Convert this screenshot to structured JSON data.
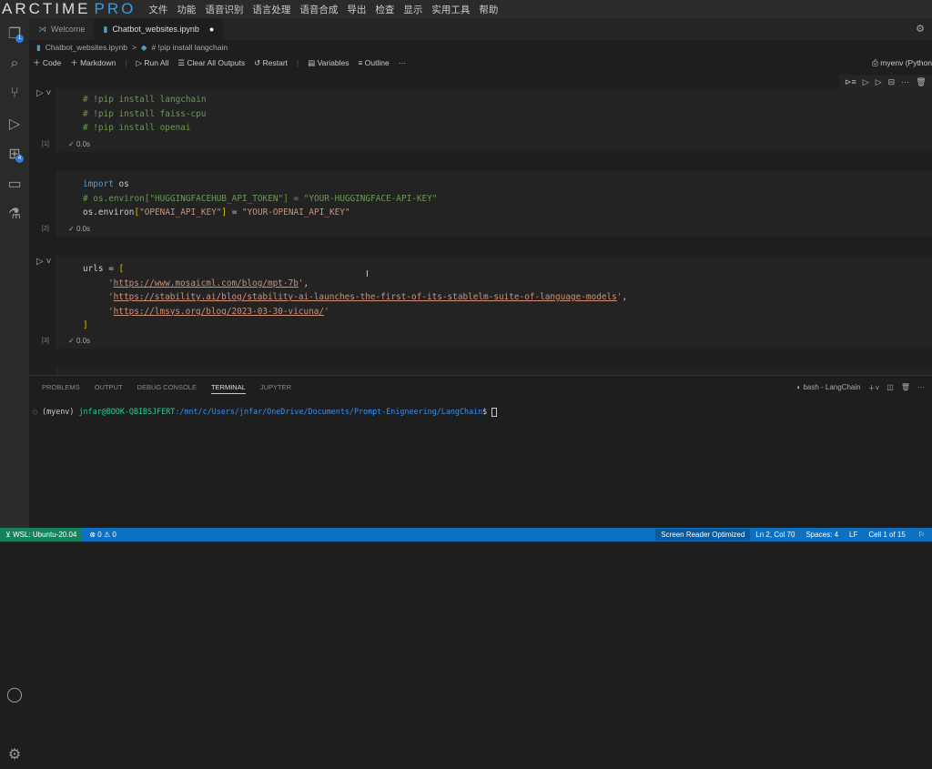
{
  "app": {
    "logo": "ARCTIME PRO",
    "menu": [
      "文件",
      "功能",
      "语音识别",
      "语言处理",
      "语音合成",
      "导出",
      "检查",
      "显示",
      "实用工具",
      "帮助"
    ]
  },
  "activity": {
    "explorer_badge": "1",
    "extensions_badge": "4"
  },
  "tabs": [
    {
      "label": "Welcome"
    },
    {
      "label": "Chatbot_websites.ipynb"
    }
  ],
  "breadcrumb": {
    "file": "Chatbot_websites.ipynb",
    "symbol": "# !pip install langchain",
    "sep": ">"
  },
  "toolbar": {
    "code": "Code",
    "markdown": "Markdown",
    "run_all": "Run All",
    "clear": "Clear All Outputs",
    "restart": "Restart",
    "variables": "Variables",
    "outline": "Outline",
    "more": "···"
  },
  "kernel": "myenv (Python",
  "cells": [
    {
      "count": "[1]",
      "time": "0.0s",
      "lines": [
        "# !pip install langchain",
        "# !pip install faiss-cpu",
        "# !pip install openai"
      ]
    },
    {
      "count": "[2]",
      "time": "0.0s",
      "import_kw": "import",
      "import_mod": " os",
      "comment": "# os.environ[\"HUGGINGFACEHUB_API_TOKEN\"] = \"YOUR-HUGGINGFACE-API-KEY\"",
      "l3a": "os.environ",
      "l3b": "[",
      "l3c": "\"OPENAI_API_KEY\"",
      "l3d": "]",
      "l3e": " = ",
      "l3f": "\"YOUR-OPENAI_API_KEY\""
    },
    {
      "count": "[3]",
      "time": "0.0s",
      "head": "urls = ",
      "open": "[",
      "close": "]",
      "urls": [
        "https://www.mosaicml.com/blog/mpt-7b",
        "https://stability.ai/blog/stability-ai-launches-the-first-of-its-stablelm-suite-of-language-models",
        "https://lmsys.org/blog/2023-03-30-vicuna/"
      ]
    }
  ],
  "panel": {
    "tabs": [
      "PROBLEMS",
      "OUTPUT",
      "DEBUG CONSOLE",
      "TERMINAL",
      "JUPYTER"
    ],
    "terminal_name": "bash - LangChain",
    "prompt": {
      "env": "(myenv) ",
      "user": "jnfar@BOOK-QBIBSJFERT",
      "path": ":/mnt/c/Users/jnfar/OneDrive/Documents/Prompt-Enigneering/LangChain",
      "dollar": "$ "
    }
  },
  "status": {
    "remote": "WSL: Ubuntu-20.04",
    "errors": "0",
    "warnings": "0",
    "screen_reader": "Screen Reader Optimized",
    "position": "Ln 2, Col 70",
    "spaces": "Spaces: 4",
    "eol": "LF",
    "cell": "Cell 1 of 15"
  }
}
